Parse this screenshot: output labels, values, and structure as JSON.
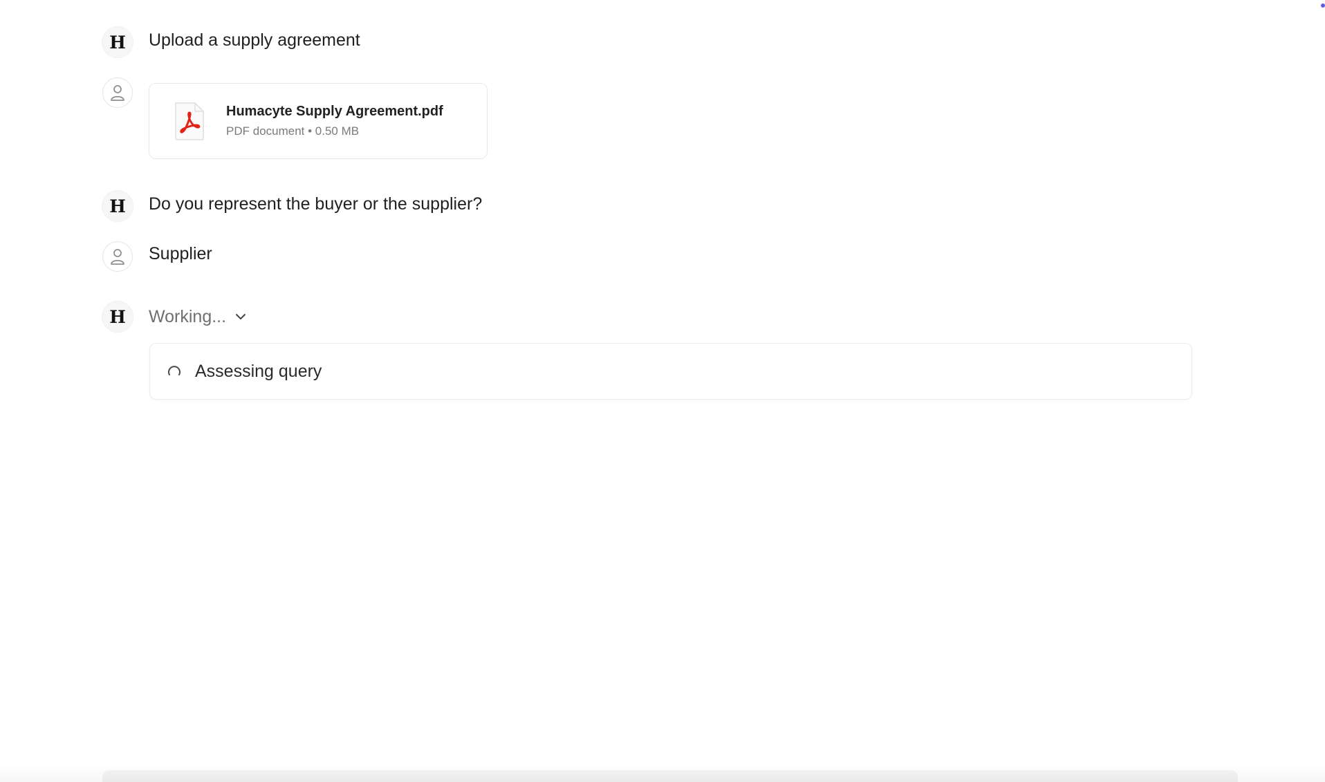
{
  "messages": [
    {
      "role": "assistant",
      "avatar_letter": "H",
      "text": "Upload a supply agreement"
    },
    {
      "role": "user",
      "avatar_icon": "user-icon",
      "file": {
        "name": "Humacyte Supply Agreement.pdf",
        "meta": "PDF document • 0.50 MB",
        "icon": "pdf-icon"
      }
    },
    {
      "role": "assistant",
      "avatar_letter": "H",
      "text": "Do you represent the buyer or the supplier?"
    },
    {
      "role": "user",
      "avatar_icon": "user-icon",
      "text": "Supplier"
    },
    {
      "role": "assistant",
      "avatar_letter": "H",
      "working_label": "Working...",
      "status": {
        "icon": "spinner-icon",
        "text": "Assessing query"
      }
    }
  ],
  "colors": {
    "pdf_red": "#e2231a",
    "accent_dot": "#5a62e0"
  }
}
